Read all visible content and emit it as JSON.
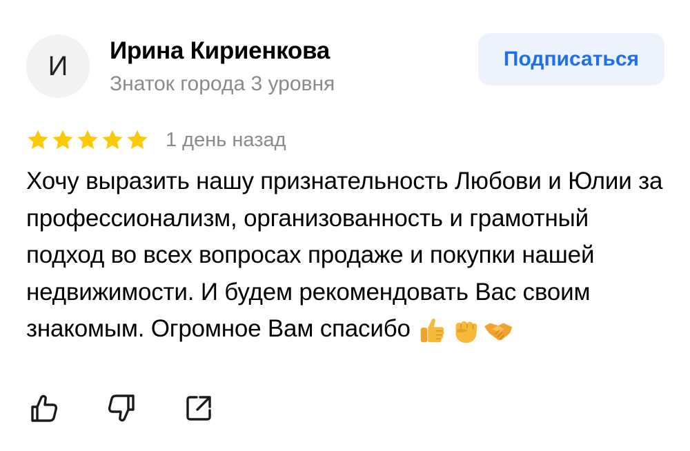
{
  "author": {
    "avatar_initial": "И",
    "name": "Ирина Кириенкова",
    "level": "Знаток города 3 уровня"
  },
  "subscribe": {
    "label": "Подписаться"
  },
  "review": {
    "rating": 5,
    "rating_max": 5,
    "date": "1 день назад",
    "text": "Хочу выразить нашу признательность Любови и Юлии за профессионализм, организованность и грамотный подход во всех вопросах продаже и покупки нашей недвижимости. И будем рекомендовать Вас своим знакомым. Огромное Вам спасибо",
    "emojis": [
      "thumbs-up-emoji",
      "raised-fist-emoji",
      "handshake-emoji"
    ]
  },
  "actions": [
    "like-icon",
    "dislike-icon",
    "share-icon"
  ],
  "colors": {
    "star": "#fcca00",
    "subscribe_text": "#1f6fe5",
    "subscribe_bg": "#edf3fc",
    "secondary_text": "#8a8a8a",
    "icon": "#1a1a1a"
  }
}
